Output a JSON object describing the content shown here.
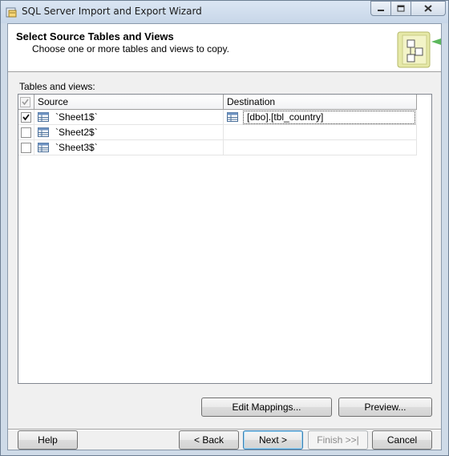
{
  "window": {
    "title": "SQL Server Import and Export Wizard"
  },
  "header": {
    "title": "Select Source Tables and Views",
    "subtitle": "Choose one or more tables and views to copy."
  },
  "tables_label": "Tables and views:",
  "grid": {
    "columns": {
      "source": "Source",
      "destination": "Destination"
    },
    "rows": [
      {
        "checked": true,
        "source": "`Sheet1$`",
        "destination": "[dbo].[tbl_country]"
      },
      {
        "checked": false,
        "source": "`Sheet2$`",
        "destination": ""
      },
      {
        "checked": false,
        "source": "`Sheet3$`",
        "destination": ""
      }
    ]
  },
  "buttons": {
    "edit_mappings": "Edit Mappings...",
    "preview": "Preview...",
    "help": "Help",
    "back": "< Back",
    "next": "Next >",
    "finish": "Finish >>|",
    "cancel": "Cancel"
  },
  "colors": {
    "frame": "#cfdbe8",
    "client": "#f0f0f0",
    "accent": "#3c7fb1"
  }
}
